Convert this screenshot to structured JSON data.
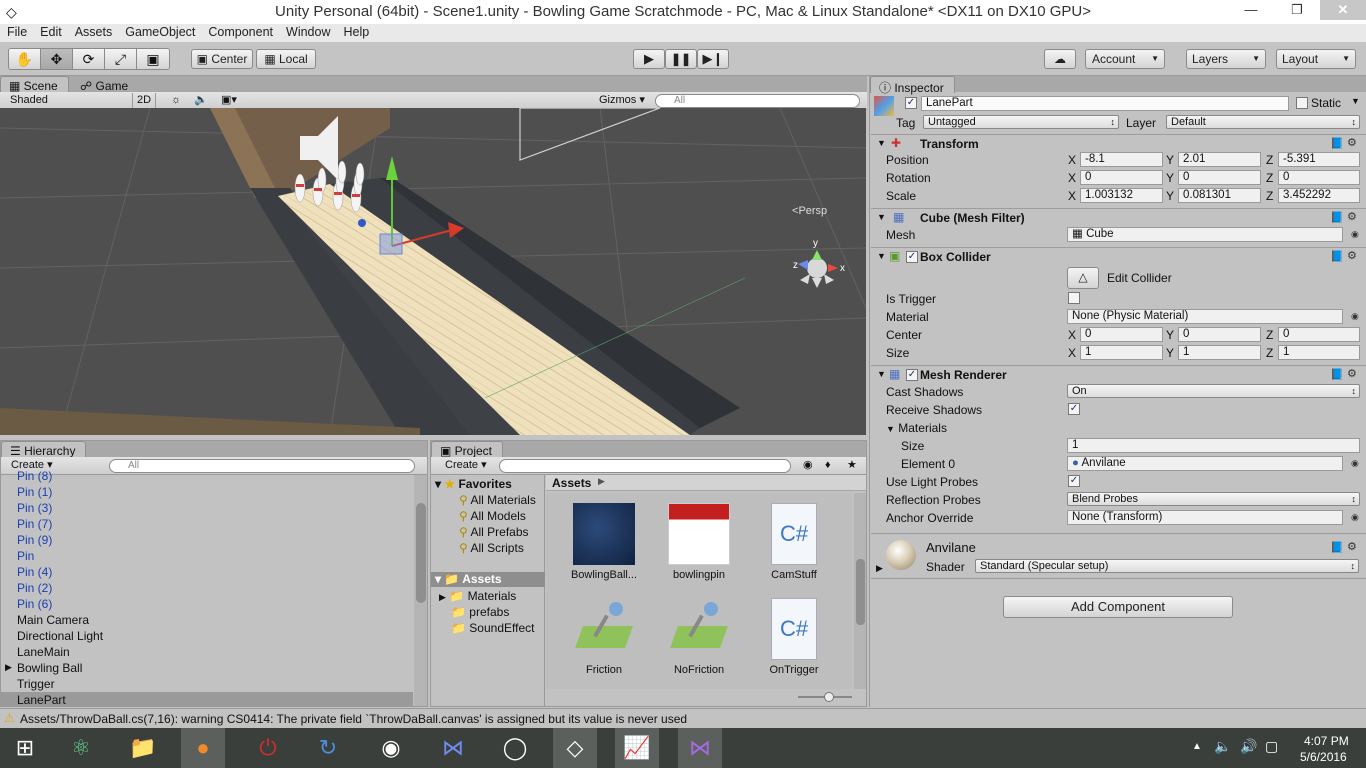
{
  "window": {
    "title": "Unity Personal (64bit) - Scene1.unity - Bowling Game Scratchmode - PC, Mac & Linux Standalone* <DX11 on DX10 GPU>"
  },
  "menu": [
    "File",
    "Edit",
    "Assets",
    "GameObject",
    "Component",
    "Window",
    "Help"
  ],
  "toolbar": {
    "center_label": "Center",
    "local_label": "Local",
    "account_label": "Account",
    "layers_label": "Layers",
    "layout_label": "Layout"
  },
  "scene": {
    "tab_scene": "Scene",
    "tab_game": "Game",
    "shading": "Shaded",
    "mode_2d": "2D",
    "gizmos_label": "Gizmos",
    "search_placeholder": "All",
    "persp_label": "Persp",
    "gizmo_x": "x",
    "gizmo_y": "y",
    "gizmo_z": "z"
  },
  "hierarchy": {
    "tab": "Hierarchy",
    "create_label": "Create",
    "search_placeholder": "All",
    "items": [
      {
        "label": "Pin (8)",
        "prefab": true
      },
      {
        "label": "Pin (1)",
        "prefab": true
      },
      {
        "label": "Pin (3)",
        "prefab": true
      },
      {
        "label": "Pin (7)",
        "prefab": true
      },
      {
        "label": "Pin (9)",
        "prefab": true
      },
      {
        "label": "Pin",
        "prefab": true
      },
      {
        "label": "Pin (4)",
        "prefab": true
      },
      {
        "label": "Pin (2)",
        "prefab": true
      },
      {
        "label": "Pin (6)",
        "prefab": true
      },
      {
        "label": "Main Camera",
        "prefab": false
      },
      {
        "label": "Directional Light",
        "prefab": false
      },
      {
        "label": "LaneMain",
        "prefab": false
      },
      {
        "label": "Bowling Ball",
        "prefab": false
      },
      {
        "label": "Trigger",
        "prefab": false
      },
      {
        "label": "LanePart",
        "prefab": false
      }
    ]
  },
  "project": {
    "tab": "Project",
    "create_label": "Create",
    "favorites_label": "Favorites",
    "favorites": [
      "All Materials",
      "All Models",
      "All Prefabs",
      "All Scripts"
    ],
    "assets_label": "Assets",
    "folders": [
      "Materials",
      "prefabs",
      "SoundEffect"
    ],
    "breadcrumb": "Assets",
    "assets": [
      {
        "name": "BowlingBall...",
        "kind": "ball"
      },
      {
        "name": "bowlingpin",
        "kind": "pin"
      },
      {
        "name": "CamStuff",
        "kind": "script"
      },
      {
        "name": "Friction",
        "kind": "physmat"
      },
      {
        "name": "NoFriction",
        "kind": "physmat"
      },
      {
        "name": "OnTrigger",
        "kind": "script"
      }
    ]
  },
  "inspector": {
    "tab": "Inspector",
    "object_name": "LanePart",
    "static_label": "Static",
    "tag_label": "Tag",
    "tag_value": "Untagged",
    "layer_label": "Layer",
    "layer_value": "Default",
    "transform": {
      "title": "Transform",
      "position_label": "Position",
      "rotation_label": "Rotation",
      "scale_label": "Scale",
      "position": {
        "x": "-8.1",
        "y": "2.01",
        "z": "-5.391"
      },
      "rotation": {
        "x": "0",
        "y": "0",
        "z": "0"
      },
      "scale": {
        "x": "1.003132",
        "y": "0.081301",
        "z": "3.452292"
      }
    },
    "mesh_filter": {
      "title": "Cube (Mesh Filter)",
      "mesh_label": "Mesh",
      "mesh_value": "Cube"
    },
    "box_collider": {
      "title": "Box Collider",
      "edit_label": "Edit Collider",
      "is_trigger_label": "Is Trigger",
      "material_label": "Material",
      "material_value": "None (Physic Material)",
      "center_label": "Center",
      "center": {
        "x": "0",
        "y": "0",
        "z": "0"
      },
      "size_label": "Size",
      "size": {
        "x": "1",
        "y": "1",
        "z": "1"
      }
    },
    "mesh_renderer": {
      "title": "Mesh Renderer",
      "cast_shadows_label": "Cast Shadows",
      "cast_shadows_value": "On",
      "receive_shadows_label": "Receive Shadows",
      "materials_label": "Materials",
      "size_label": "Size",
      "size_value": "1",
      "element0_label": "Element 0",
      "element0_value": "Anvilane",
      "light_probes_label": "Use Light Probes",
      "reflection_probes_label": "Reflection Probes",
      "reflection_probes_value": "Blend Probes",
      "anchor_override_label": "Anchor Override",
      "anchor_override_value": "None (Transform)"
    },
    "material": {
      "name": "Anvilane",
      "shader_label": "Shader",
      "shader_value": "Standard (Specular setup)"
    },
    "add_component_label": "Add Component",
    "axis_x": "X",
    "axis_y": "Y",
    "axis_z": "Z"
  },
  "status": {
    "message": "Assets/ThrowDaBall.cs(7,16): warning CS0414: The private field `ThrowDaBall.canvas' is assigned but its value is never used"
  },
  "taskbar": {
    "time": "4:07 PM",
    "date": "5/6/2016"
  }
}
